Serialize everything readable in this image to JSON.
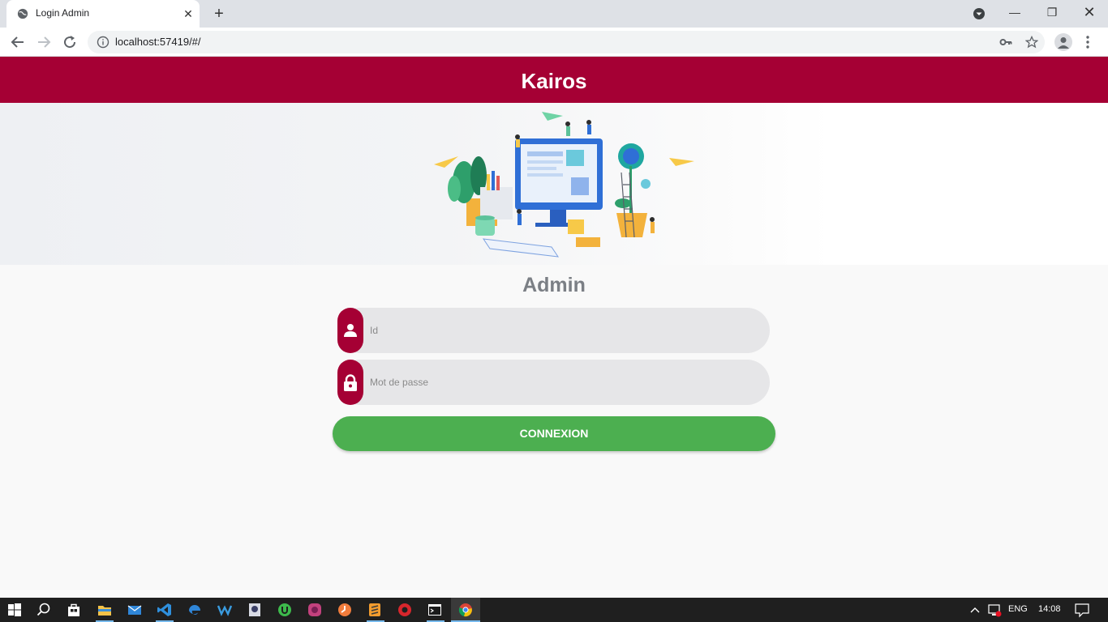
{
  "browser": {
    "tab_title": "Login Admin",
    "url": "localhost:57419/#/"
  },
  "page": {
    "brand": "Kairos",
    "form_title": "Admin",
    "id_placeholder": "Id",
    "password_placeholder": "Mot de passe",
    "login_button": "CONNEXION"
  },
  "colors": {
    "brand": "#a50034",
    "button": "#4caf50",
    "title": "#7b7f85"
  },
  "taskbar": {
    "language": "ENG",
    "time": "14:08",
    "apps": [
      "windows-start-icon",
      "search-icon",
      "store-icon",
      "file-explorer-icon",
      "mail-icon",
      "vscode-icon",
      "edge-icon",
      "wps-icon",
      "app-icon",
      "upwork-icon",
      "app-icon",
      "clock-app-icon",
      "sublime-icon",
      "app-icon",
      "cmd-icon",
      "chrome-icon"
    ]
  }
}
